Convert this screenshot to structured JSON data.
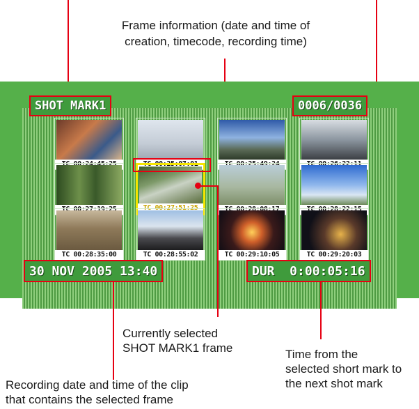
{
  "callouts": {
    "frame_info_line1": "Frame information (date and time of",
    "frame_info_line2": "creation, timecode, recording time)",
    "selected_line1": "Currently selected",
    "selected_line2": "SHOT MARK1 frame",
    "rec_date_line1": "Recording date and time of the clip",
    "rec_date_line2": "that contains the selected frame",
    "dur_line1": "Time from the",
    "dur_line2": "selected short mark to",
    "dur_line3": "the next shot mark"
  },
  "osd": {
    "mark_label": "SHOT MARK1",
    "counter": "0006/0036",
    "rec_datetime": "30 NOV 2005 13:40",
    "duration": "DUR  0:00:05:16"
  },
  "thumbnails": [
    {
      "tc": "TC 00:24:45:25",
      "scene": "people-indoor"
    },
    {
      "tc": "TC 00:25:07:01",
      "scene": "snow-figure"
    },
    {
      "tc": "TC 00:25:49:24",
      "scene": "volcano-sky"
    },
    {
      "tc": "TC 00:26:22:11",
      "scene": "car-interior"
    },
    {
      "tc": "TC 00:27:19:25",
      "scene": "forest"
    },
    {
      "tc": "TC 00:27:51:25",
      "scene": "river-rocks",
      "selected": true
    },
    {
      "tc": "TC 00:28:08:17",
      "scene": "misty-landscape"
    },
    {
      "tc": "TC 00:28:22:15",
      "scene": "blue-sky-clouds"
    },
    {
      "tc": "TC 00:28:35:00",
      "scene": "ruins"
    },
    {
      "tc": "TC 00:28:55:02",
      "scene": "road-windshield"
    },
    {
      "tc": "TC 00:29:10:05",
      "scene": "night-carousel"
    },
    {
      "tc": "TC 00:29:20:03",
      "scene": "night-lights"
    }
  ],
  "colors": {
    "screen_green": "#55b04a",
    "callout_red": "#e60012",
    "selection_yellow": "#f5e500"
  }
}
